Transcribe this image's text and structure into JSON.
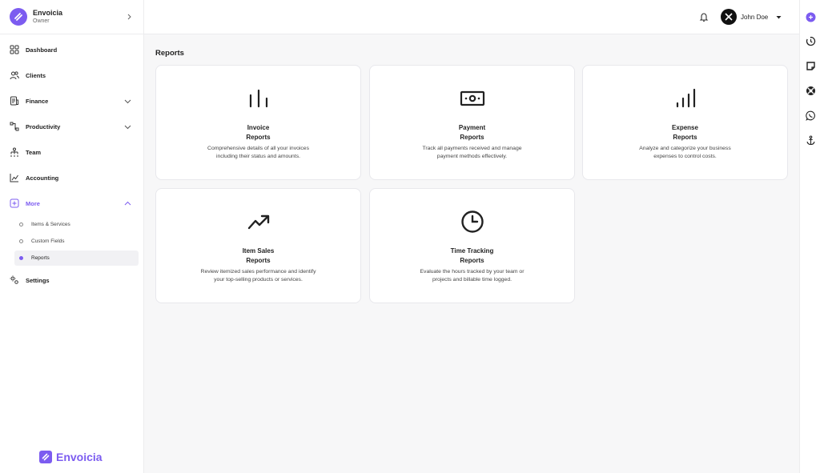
{
  "org": {
    "name": "Envoicia",
    "role": "Owner"
  },
  "nav": {
    "dashboard": "Dashboard",
    "clients": "Clients",
    "finance": "Finance",
    "productivity": "Productivity",
    "team": "Team",
    "accounting": "Accounting",
    "more": "More",
    "more_items": [
      "Items & Services",
      "Custom Fields",
      "Reports"
    ],
    "settings": "Settings"
  },
  "brand": {
    "name": "Envoicia"
  },
  "topbar": {
    "user_name": "John Doe"
  },
  "page": {
    "title": "Reports"
  },
  "cards": [
    {
      "title_line1": "Invoice",
      "title_line2": "Reports",
      "desc_line1": "Comprehensive details of all your invoices",
      "desc_line2": "including their status and amounts.",
      "icon": "bar-chart-icon"
    },
    {
      "title_line1": "Payment",
      "title_line2": "Reports",
      "desc_line1": "Track all payments received and manage",
      "desc_line2": "payment methods effectively.",
      "icon": "banknote-icon"
    },
    {
      "title_line1": "Expense",
      "title_line2": "Reports",
      "desc_line1": "Analyze and categorize your business",
      "desc_line2": "expenses to control costs.",
      "icon": "signal-bars-icon"
    },
    {
      "title_line1": "Item Sales",
      "title_line2": "Reports",
      "desc_line1": "Review itemized sales performance and identify",
      "desc_line2": "your top-selling products or services.",
      "icon": "trending-up-icon"
    },
    {
      "title_line1": "Time Tracking",
      "title_line2": "Reports",
      "desc_line1": "Evaluate the hours tracked by your team or",
      "desc_line2": "projects and billable time logged.",
      "icon": "clock-icon"
    }
  ],
  "colors": {
    "accent": "#7c5cf0",
    "text": "#222222",
    "background": "#f7f7f8"
  }
}
